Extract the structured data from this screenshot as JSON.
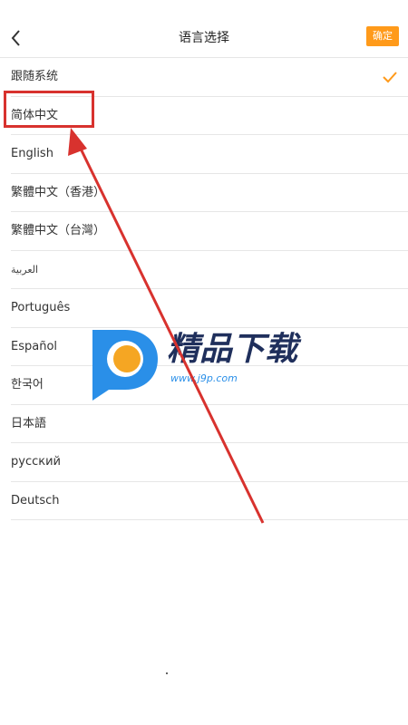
{
  "header": {
    "title": "语言选择",
    "confirm_label": "确定"
  },
  "languages": [
    {
      "label": "跟随系统",
      "selected": true
    },
    {
      "label": "简体中文",
      "selected": false
    },
    {
      "label": "English",
      "selected": false
    },
    {
      "label": "繁體中文（香港）",
      "selected": false
    },
    {
      "label": "繁體中文（台灣）",
      "selected": false
    },
    {
      "label": "العربية",
      "selected": false
    },
    {
      "label": "Português",
      "selected": false
    },
    {
      "label": "Español",
      "selected": false
    },
    {
      "label": "한국어",
      "selected": false
    },
    {
      "label": "日本語",
      "selected": false
    },
    {
      "label": "русский",
      "selected": false
    },
    {
      "label": "Deutsch",
      "selected": false
    }
  ],
  "watermark": {
    "title": "精品下载",
    "url": "www.j9p.com"
  },
  "colors": {
    "accent": "#ff9a1a",
    "annotation": "#d8322e"
  }
}
